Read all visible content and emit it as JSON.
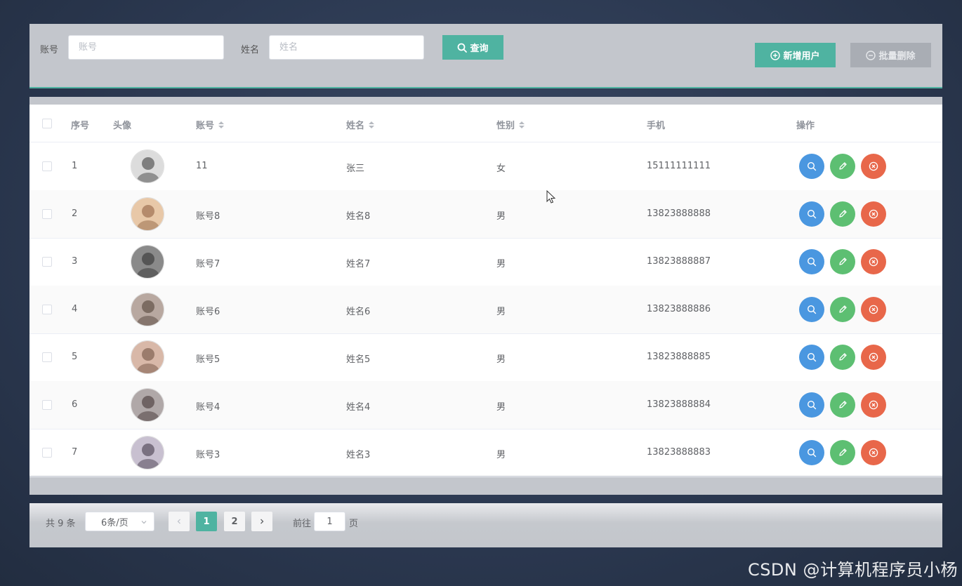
{
  "search": {
    "account_label": "账号",
    "account_placeholder": "账号",
    "name_label": "姓名",
    "name_placeholder": "姓名",
    "query_label": "查询"
  },
  "toolbar": {
    "add_label": "新增用户",
    "batch_delete_label": "批量删除"
  },
  "table": {
    "headers": {
      "index": "序号",
      "avatar": "头像",
      "account": "账号",
      "name": "姓名",
      "gender": "性别",
      "phone": "手机",
      "actions": "操作"
    },
    "rows": [
      {
        "index": "1",
        "account": "11",
        "name": "张三",
        "gender": "女",
        "phone": "15111111111"
      },
      {
        "index": "2",
        "account": "账号8",
        "name": "姓名8",
        "gender": "男",
        "phone": "13823888888"
      },
      {
        "index": "3",
        "account": "账号7",
        "name": "姓名7",
        "gender": "男",
        "phone": "13823888887"
      },
      {
        "index": "4",
        "account": "账号6",
        "name": "姓名6",
        "gender": "男",
        "phone": "13823888886"
      },
      {
        "index": "5",
        "account": "账号5",
        "name": "姓名5",
        "gender": "男",
        "phone": "13823888885"
      },
      {
        "index": "6",
        "account": "账号4",
        "name": "姓名4",
        "gender": "男",
        "phone": "13823888884"
      },
      {
        "index": "7",
        "account": "账号3",
        "name": "姓名3",
        "gender": "男",
        "phone": "13823888883"
      }
    ]
  },
  "pagination": {
    "total": "共 9 条",
    "page_size": "6条/页",
    "pages": [
      "1",
      "2"
    ],
    "current_page": "1",
    "goto_label": "前往",
    "goto_value": "1",
    "page_suffix": "页"
  },
  "watermark": "CSDN @计算机程序员小杨",
  "colors": {
    "accent": "#4fb3a1",
    "view": "#4a97e0",
    "edit": "#5dbf72",
    "delete": "#e8674a"
  },
  "icons": {
    "query": "search-icon",
    "add": "plus-circle-icon",
    "batch_delete": "minus-circle-icon",
    "view": "search-icon",
    "edit": "pencil-icon",
    "remove": "close-circle-icon"
  }
}
